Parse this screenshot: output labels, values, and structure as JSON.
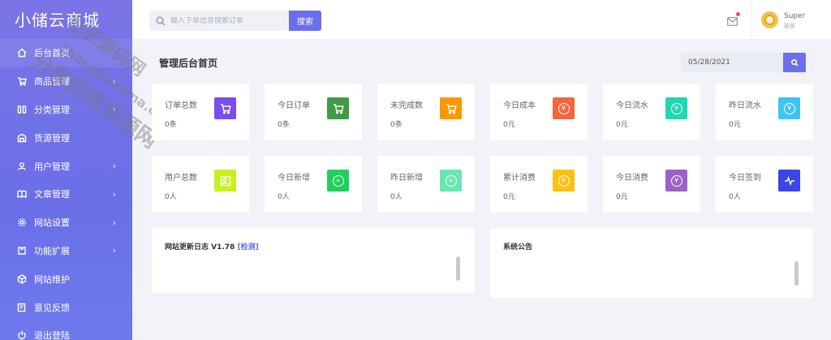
{
  "brand": "小储云商城",
  "sidebar": {
    "items": [
      {
        "label": "后台首页",
        "icon": "home-icon",
        "arrow": ""
      },
      {
        "label": "商品管理",
        "icon": "cart-icon",
        "arrow": "›"
      },
      {
        "label": "分类管理",
        "icon": "category-icon",
        "arrow": "›"
      },
      {
        "label": "货源管理",
        "icon": "warehouse-icon",
        "arrow": ""
      },
      {
        "label": "用户管理",
        "icon": "user-icon",
        "arrow": "›"
      },
      {
        "label": "文章管理",
        "icon": "book-icon",
        "arrow": "›"
      },
      {
        "label": "网站设置",
        "icon": "gear-icon",
        "arrow": "›"
      },
      {
        "label": "功能扩展",
        "icon": "puzzle-icon",
        "arrow": "›"
      },
      {
        "label": "网站维护",
        "icon": "cube-icon",
        "arrow": ""
      },
      {
        "label": "意见反馈",
        "icon": "feedback-icon",
        "arrow": ""
      },
      {
        "label": "退出登陆",
        "icon": "power-icon",
        "arrow": ""
      }
    ]
  },
  "watermark": {
    "text1": "站长源码网",
    "text2": "zhangyuanma.com",
    "text3": "分享网络资源网"
  },
  "header": {
    "search_placeholder": "输入下单信息搜索订单",
    "search_button": "搜索",
    "user_name": "Super",
    "user_role": "站长"
  },
  "page": {
    "title": "管理后台首页",
    "date_value": "05/28/2021"
  },
  "stats_row1": [
    {
      "title": "订单总数",
      "value": "0条",
      "color": "#7b4cf0",
      "icon": "cart-icon"
    },
    {
      "title": "今日订单",
      "value": "0条",
      "color": "#3f9c45",
      "icon": "cart-icon"
    },
    {
      "title": "未完成数",
      "value": "0条",
      "color": "#ff9800",
      "icon": "cart-icon"
    },
    {
      "title": "今日成本",
      "value": "0元",
      "color": "#f5663c",
      "icon": "yen-icon"
    },
    {
      "title": "今日流水",
      "value": "0元",
      "color": "#1fd9b0",
      "icon": "yen-icon"
    },
    {
      "title": "昨日流水",
      "value": "0元",
      "color": "#3ec4f2",
      "icon": "yen-icon"
    }
  ],
  "stats_row2": [
    {
      "title": "用户总数",
      "value": "0人",
      "color": "#c6f020",
      "icon": "users-icon"
    },
    {
      "title": "今日新增",
      "value": "0人",
      "color": "#1ed15c",
      "icon": "plus-circle-icon"
    },
    {
      "title": "昨日新增",
      "value": "0人",
      "color": "#68e8b0",
      "icon": "plus-circle-icon"
    },
    {
      "title": "累计消费",
      "value": "0元",
      "color": "#fcc112",
      "icon": "yen-icon"
    },
    {
      "title": "今日消费",
      "value": "0元",
      "color": "#9a62c8",
      "icon": "yen-icon"
    },
    {
      "title": "今日签到",
      "value": "0人",
      "color": "#3b45e8",
      "icon": "pulse-icon"
    }
  ],
  "panels": {
    "log_title": "网站更新日志 V1.78",
    "log_link": "[检测]",
    "notice_title": "系统公告"
  }
}
